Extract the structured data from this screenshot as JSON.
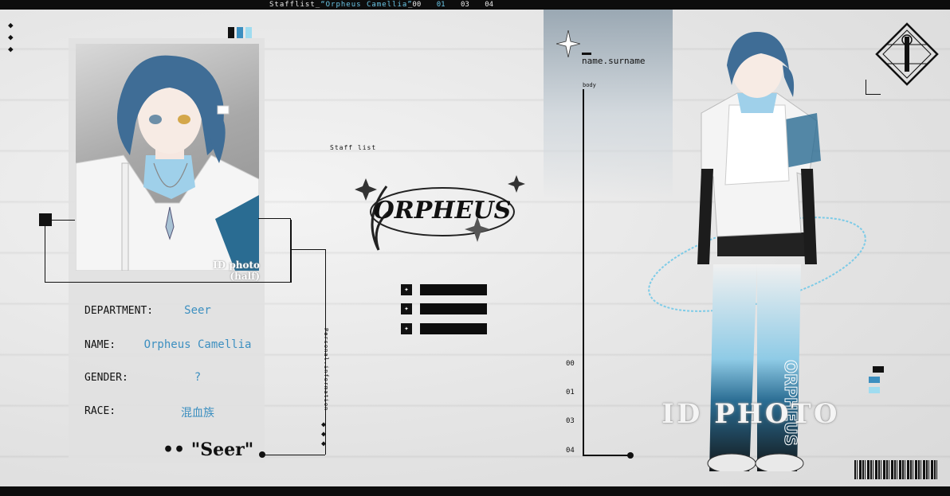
{
  "topbar": {
    "title_prefix": "Stafflist_",
    "title_name": "“Orpheus Camellia”",
    "nums": [
      "_00",
      "01",
      "03",
      "04"
    ],
    "active_index": 1
  },
  "card": {
    "photo_caption": "ID photo (half)",
    "fields": [
      {
        "label": "DEPARTMENT:",
        "value": "Seer"
      },
      {
        "label": "NAME:",
        "value": "Orpheus Camellia"
      },
      {
        "label": "GENDER:",
        "value": "?"
      },
      {
        "label": "RACE:",
        "value": "混血族"
      }
    ],
    "quote": "•• \"Seer\"",
    "vertical_text": "Personal.information"
  },
  "center": {
    "stafflist_label": "Staff list",
    "logo_text": "ORPHEUS"
  },
  "profile": {
    "name_label": "name.surname",
    "body_label": "body",
    "indices": [
      "00",
      "01",
      "03",
      "04"
    ],
    "id_photo": "ID PHOTO",
    "side_text": "ORPHEUS"
  },
  "colors": {
    "accent": "#3c8fc0",
    "accent_light": "#6bc7e8",
    "dark": "#0d0d0d"
  }
}
